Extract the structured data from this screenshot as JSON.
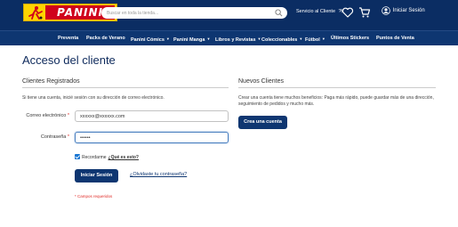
{
  "header": {
    "logo_text": "PANINI",
    "search": {
      "placeholder": "Buscar en toda la tienda..."
    },
    "service_link": "Servicio al Cliente",
    "login_link": "Iniciar Sesión"
  },
  "nav": {
    "items": [
      {
        "label": "Preventa",
        "has_dropdown": false
      },
      {
        "label": "Packs de Verano",
        "has_dropdown": false
      },
      {
        "label": "Panini Cómics",
        "has_dropdown": true
      },
      {
        "label": "Panini Manga",
        "has_dropdown": true
      },
      {
        "label": "Libros y Revistas",
        "has_dropdown": true
      },
      {
        "label": "Coleccionables",
        "has_dropdown": true
      },
      {
        "label": "Fútbol",
        "has_dropdown": true
      },
      {
        "label": "Últimos Stickers",
        "has_dropdown": false
      },
      {
        "label": "Puntos de Venta",
        "has_dropdown": false
      }
    ]
  },
  "main": {
    "page_title": "Acceso del cliente",
    "registered": {
      "title": "Clientes Registrados",
      "intro": "Si tiene una cuenta, inicié sesión con su dirección de correo electrónico.",
      "email_label": "Correo electrónico",
      "email_value": "xxxxxx@xxxxxx.com",
      "password_label": "Contraseña",
      "password_value": "••••••",
      "remember_label": "Recordarme",
      "remember_checked": true,
      "what_is_this": "¿Qué es esto?",
      "login_button": "Iniciar Sesión",
      "forgot_link": "¿Olvidaste tu contraseña?",
      "required_note": "* Campos requeridos",
      "required_mark": "*"
    },
    "new": {
      "title": "Nuevos Clientes",
      "intro": "Crear una cuenta tiene muchos beneficios: Paga más rápido, puede guardar más de una dirección, seguimiento de pedidos y mucho más.",
      "create_button": "Crea una cuenta"
    }
  },
  "colors": {
    "header_bg": "#0b2d63",
    "nav_bg": "#0e3671",
    "button_bg": "#0e3671",
    "logo_yellow": "#ffd400",
    "logo_red": "#d0021b",
    "required_red": "#e02b27"
  }
}
